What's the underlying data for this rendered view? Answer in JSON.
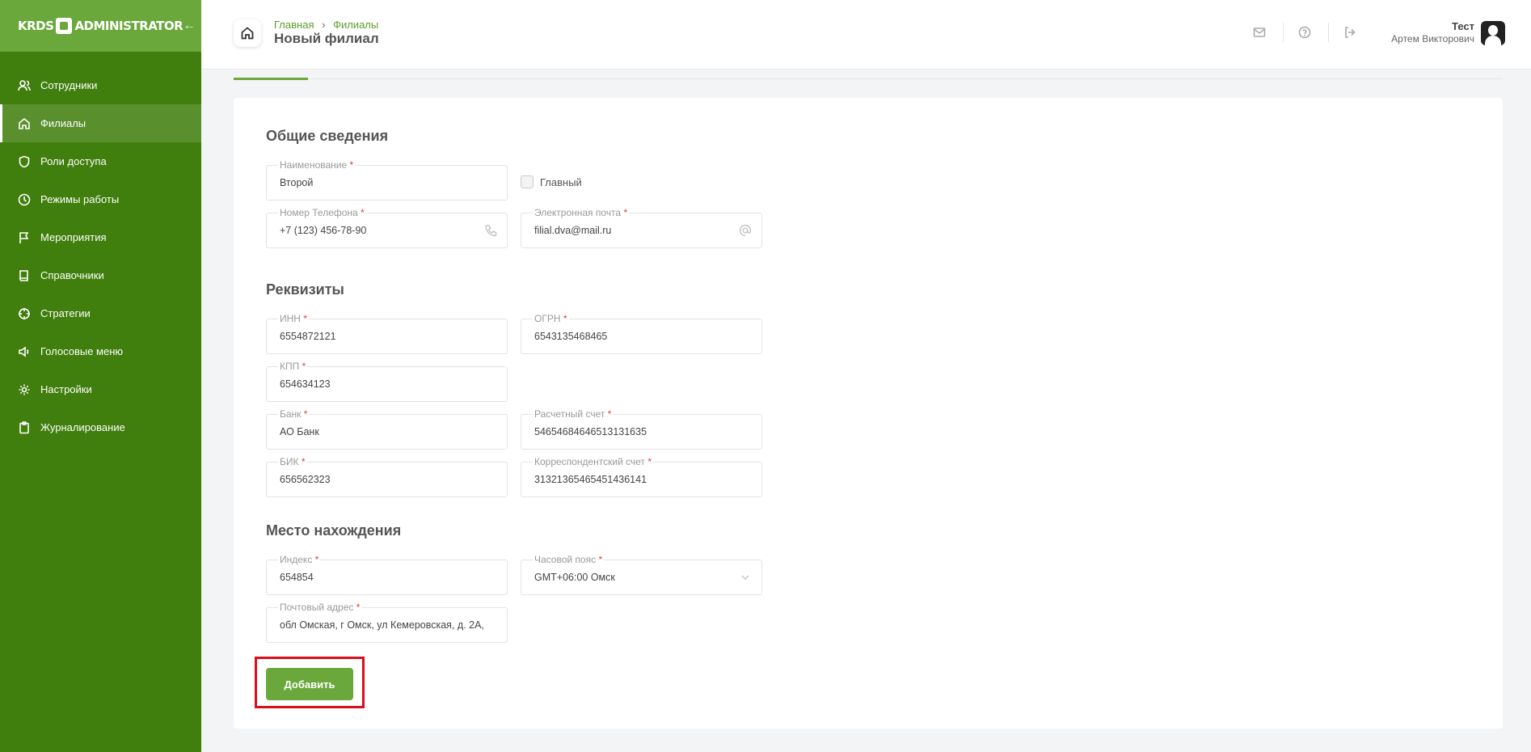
{
  "app": {
    "logo_left": "KRDS",
    "logo_right": "ADMINISTRATOR"
  },
  "sidebar": {
    "items": [
      {
        "label": "Сотрудники",
        "icon": "users-icon"
      },
      {
        "label": "Филиалы",
        "icon": "home-icon",
        "active": true
      },
      {
        "label": "Роли доступа",
        "icon": "shield-icon"
      },
      {
        "label": "Режимы работы",
        "icon": "clock-icon"
      },
      {
        "label": "Мероприятия",
        "icon": "flag-icon"
      },
      {
        "label": "Справочники",
        "icon": "book-icon"
      },
      {
        "label": "Стратегии",
        "icon": "crosshair-icon"
      },
      {
        "label": "Голосовые меню",
        "icon": "speaker-icon"
      },
      {
        "label": "Настройки",
        "icon": "gear-icon"
      },
      {
        "label": "Журналирование",
        "icon": "clipboard-icon"
      }
    ]
  },
  "header": {
    "breadcrumb": [
      "Главная",
      "Филиалы"
    ],
    "title": "Новый филиал",
    "user_name": "Тест",
    "user_full": "Артем Викторович"
  },
  "form": {
    "general": {
      "title": "Общие сведения",
      "name": {
        "label": "Наименование",
        "value": "Второй"
      },
      "main_checkbox": {
        "label": "Главный",
        "checked": false
      },
      "phone": {
        "label": "Номер Телефона",
        "value": "+7 (123) 456-78-90"
      },
      "email": {
        "label": "Электронная почта",
        "value": "filial.dva@mail.ru"
      }
    },
    "requisites": {
      "title": "Реквизиты",
      "inn": {
        "label": "ИНН",
        "value": "6554872121"
      },
      "ogrn": {
        "label": "ОГРН",
        "value": "6543135468465"
      },
      "kpp": {
        "label": "КПП",
        "value": "654634123"
      },
      "bank": {
        "label": "Банк",
        "value": "АО Банк"
      },
      "account": {
        "label": "Расчетный счет",
        "value": "54654684646513131635"
      },
      "bik": {
        "label": "БИК",
        "value": "656562323"
      },
      "corr_account": {
        "label": "Корреспондентский счет",
        "value": "31321365465451436141"
      }
    },
    "location": {
      "title": "Место нахождения",
      "index": {
        "label": "Индекс",
        "value": "654854"
      },
      "timezone": {
        "label": "Часовой пояс",
        "value": "GMT+06:00 Омск"
      },
      "address": {
        "label": "Почтовый адрес",
        "value": "обл Омская, г Омск, ул Кемеровская, д. 2А,"
      }
    },
    "submit_label": "Добавить",
    "required_mark": "*"
  },
  "colors": {
    "sidebar": "#407e0d",
    "accent": "#6aa83b",
    "highlight": "#d90f1d"
  }
}
